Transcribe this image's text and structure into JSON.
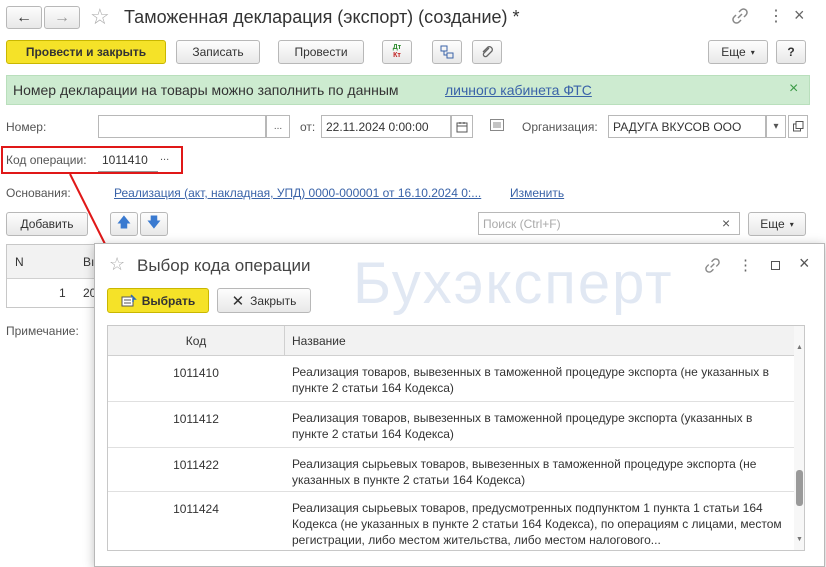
{
  "window": {
    "title": "Таможенная декларация (экспорт) (создание) *",
    "nav_back": "←",
    "nav_forward": "→"
  },
  "toolbar": {
    "post_close": "Провести и закрыть",
    "save": "Записать",
    "post": "Провести",
    "dt_kt": "Дт Кт",
    "more": "Еще",
    "help": "?"
  },
  "banner": {
    "text": "Номер декларации на товары можно заполнить по данным ",
    "link": "личного кабинета ФТС",
    "close": "×"
  },
  "form": {
    "number_label": "Номер:",
    "number_value": "",
    "from_label": "от:",
    "date_value": "22.11.2024  0:00:00",
    "org_label": "Организация:",
    "org_value": "РАДУГА ВКУСОВ ООО",
    "opcode_label": "Код операции:",
    "opcode_value": "1011410",
    "basis_label": "Основания:",
    "basis_link": "Реализация (акт, накладная, УПД) 0000-000001 от 16.10.2024 0:...",
    "change_link": "Изменить",
    "add_button": "Добавить",
    "search_placeholder": "Поиск (Ctrl+F)",
    "more": "Еще",
    "note_label": "Примечание:"
  },
  "table": {
    "col_n": "N",
    "col_v": "Вı",
    "row_n": "1",
    "row_v": "20"
  },
  "dialog": {
    "title": "Выбор кода операции",
    "select_button": "Выбрать",
    "close_button": "Закрыть",
    "col_code": "Код",
    "col_name": "Название",
    "rows": [
      {
        "code": "1011410",
        "name": "Реализация товаров, вывезенных в таможенной процедуре экспорта (не указанных в пункте 2 статьи 164 Кодекса)"
      },
      {
        "code": "1011412",
        "name": "Реализация товаров, вывезенных в таможенной процедуре экспорта (указанных в пункте 2 статьи 164 Кодекса)"
      },
      {
        "code": "1011422",
        "name": "Реализация сырьевых товаров, вывезенных в таможенной процедуре экспорта (не указанных в пункте 2 статьи 164 Кодекса)"
      },
      {
        "code": "1011424",
        "name": "Реализация сырьевых товаров, предусмотренных подпунктом 1 пункта 1 статьи 164 Кодекса (не указанных в пункте 2 статьи 164 Кодекса), по операциям с лицами, местом регистрации, либо местом жительства, либо местом налогового..."
      }
    ]
  },
  "watermark": "Бухэксперт",
  "colors": {
    "accent_yellow": "#f5e228",
    "banner_green": "#cdebd0",
    "highlight_red": "#e01818",
    "link_blue": "#3a63a8"
  }
}
